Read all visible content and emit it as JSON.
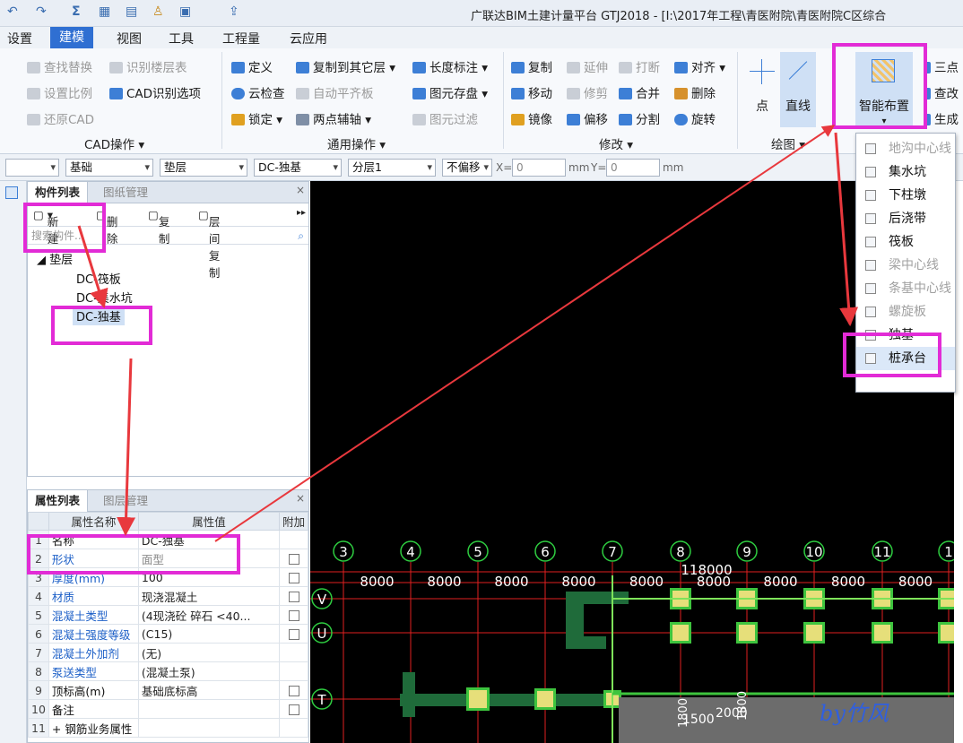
{
  "title": "广联达BIM土建计量平台 GTJ2018 - [I:\\2017年工程\\青医附院\\青医附院C区综合",
  "menu": [
    "设置",
    "建模",
    "视图",
    "工具",
    "工程量",
    "云应用"
  ],
  "ribbon": {
    "cad": {
      "find_replace": "查找替换",
      "identify_floor_table": "识别楼层表",
      "set_ratio": "设置比例",
      "cad_identify_options": "CAD识别选项",
      "restore_cad": "还原CAD",
      "label": "CAD操作"
    },
    "common": {
      "define": "定义",
      "copy_to_other_floor": "复制到其它层",
      "length_dim": "长度标注",
      "cloud_check": "云检查",
      "auto_align_slab": "自动平齐板",
      "save_element": "图元存盘",
      "lock": "锁定",
      "two_point_axis": "两点辅轴",
      "element_filter": "图元过滤",
      "label": "通用操作"
    },
    "modify": {
      "copy": "复制",
      "extend": "延伸",
      "break": "打断",
      "align": "对齐",
      "move": "移动",
      "trim": "修剪",
      "merge": "合并",
      "delete": "删除",
      "mirror": "镜像",
      "offset": "偏移",
      "split": "分割",
      "rotate": "旋转",
      "label": "修改"
    },
    "draw": {
      "point": "点",
      "line": "直线",
      "label": "绘图"
    },
    "smart": {
      "label": "智能布置",
      "three": "三点",
      "query": "查改",
      "generate": "生成"
    }
  },
  "toolbar2": {
    "combo1": "",
    "combo2": "基础",
    "combo3": "垫层",
    "combo4": "DC-独基",
    "combo5": "分层1",
    "combo6": "不偏移",
    "x_label": "X=",
    "x_value": "0",
    "x_unit": "mm",
    "y_label": "Y=",
    "y_value": "0",
    "y_unit": "mm"
  },
  "component_panel": {
    "tabs": [
      "构件列表",
      "图纸管理"
    ],
    "toolbar": {
      "new": "新建",
      "delete": "删除",
      "copy": "复制",
      "floor_copy": "层间复制"
    },
    "search_placeholder": "搜索构件...",
    "tree": {
      "root": "垫层",
      "items": [
        "DC-筏板",
        "DC-集水坑",
        "DC-独基"
      ]
    }
  },
  "property_panel": {
    "tabs": [
      "属性列表",
      "图层管理"
    ],
    "headers": [
      "属性名称",
      "属性值",
      "附加"
    ],
    "rows": [
      {
        "n": "1",
        "name": "名称",
        "value": "DC-独基",
        "blue": false,
        "cb": false
      },
      {
        "n": "2",
        "name": "形状",
        "value": "面型",
        "blue": true,
        "cb": true
      },
      {
        "n": "3",
        "name": "厚度(mm)",
        "value": "100",
        "blue": true,
        "cb": true
      },
      {
        "n": "4",
        "name": "材质",
        "value": "现浇混凝土",
        "blue": true,
        "cb": true
      },
      {
        "n": "5",
        "name": "混凝土类型",
        "value": "(4现浇砼 碎石 <40...",
        "blue": true,
        "cb": true
      },
      {
        "n": "6",
        "name": "混凝土强度等级",
        "value": "(C15)",
        "blue": true,
        "cb": true
      },
      {
        "n": "7",
        "name": "混凝土外加剂",
        "value": "(无)",
        "blue": true,
        "cb": false
      },
      {
        "n": "8",
        "name": "泵送类型",
        "value": "(混凝土泵)",
        "blue": true,
        "cb": false
      },
      {
        "n": "9",
        "name": "顶标高(m)",
        "value": "基础底标高",
        "blue": false,
        "cb": true
      },
      {
        "n": "10",
        "name": "备注",
        "value": "",
        "blue": false,
        "cb": true
      },
      {
        "n": "11",
        "name": "+ 钢筋业务属性",
        "value": "",
        "blue": false,
        "cb": false
      }
    ]
  },
  "dropdown": {
    "items": [
      {
        "label": "地沟中心线",
        "disabled": true
      },
      {
        "label": "集水坑",
        "disabled": false
      },
      {
        "label": "下柱墩",
        "disabled": false
      },
      {
        "label": "后浇带",
        "disabled": false
      },
      {
        "label": "筏板",
        "disabled": false
      },
      {
        "label": "梁中心线",
        "disabled": true
      },
      {
        "label": "条基中心线",
        "disabled": true
      },
      {
        "label": "螺旋板",
        "disabled": true
      },
      {
        "label": "独基",
        "disabled": false
      },
      {
        "label": "桩承台",
        "disabled": false
      }
    ]
  },
  "canvas": {
    "axes_top": [
      "3",
      "4",
      "5",
      "6",
      "7",
      "8",
      "9",
      "10",
      "11",
      "1"
    ],
    "spacings": [
      "8000",
      "8000",
      "8000",
      "8000",
      "8000",
      "8000",
      "8000",
      "8000",
      "8000"
    ],
    "total": "118000",
    "axes_left": [
      "V",
      "U",
      "T"
    ],
    "dims_bottom": [
      "1500",
      "2000",
      "1800",
      "1800"
    ],
    "watermark": "by竹风"
  },
  "colors": {
    "highlight": "#e22bd6",
    "arrow": "#e8383d",
    "accent": "#2f6fd2",
    "canvas_bg": "#000000",
    "axis": "#2ecc40"
  }
}
